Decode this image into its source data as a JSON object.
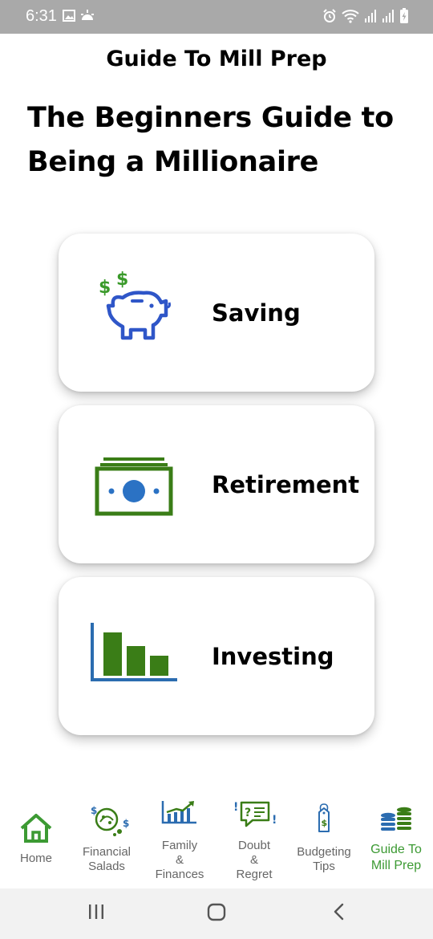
{
  "status_bar": {
    "time": "6:31",
    "left_icons": [
      "image-icon",
      "weather-icon"
    ],
    "right_icons": [
      "alarm-icon",
      "wifi-icon",
      "signal-icon",
      "signal-icon",
      "battery-charging-icon"
    ]
  },
  "header": {
    "app_title": "Guide To  Mill Prep",
    "hero_title": "The Beginners Guide to Being a Millionaire"
  },
  "cards": [
    {
      "label": "Saving",
      "icon": "piggy-bank-icon"
    },
    {
      "label": "Retirement",
      "icon": "cash-stack-icon"
    },
    {
      "label": "Investing",
      "icon": "bar-chart-icon"
    }
  ],
  "bottom_nav": {
    "items": [
      {
        "label": "Home",
        "icon": "home-icon"
      },
      {
        "label": "Financial\nSalads",
        "icon": "money-salad-icon"
      },
      {
        "label": "Family\n&\nFinances",
        "icon": "trend-chart-icon"
      },
      {
        "label": "Doubt\n&\nRegret",
        "icon": "question-note-icon"
      },
      {
        "label": "Budgeting\nTips",
        "icon": "price-tag-icon"
      },
      {
        "label": "Guide To\nMill Prep",
        "icon": "coin-stack-icon"
      }
    ],
    "active": "Guide To\nMill Prep"
  },
  "colors": {
    "status_bar": "#a9a9a9",
    "icon_blue": "#2f56c8",
    "icon_green": "#3a7d17",
    "active_green": "#3c9a33",
    "chart_blue": "#2b6cb0"
  },
  "system_nav": [
    "recents-button",
    "home-button",
    "back-button"
  ]
}
